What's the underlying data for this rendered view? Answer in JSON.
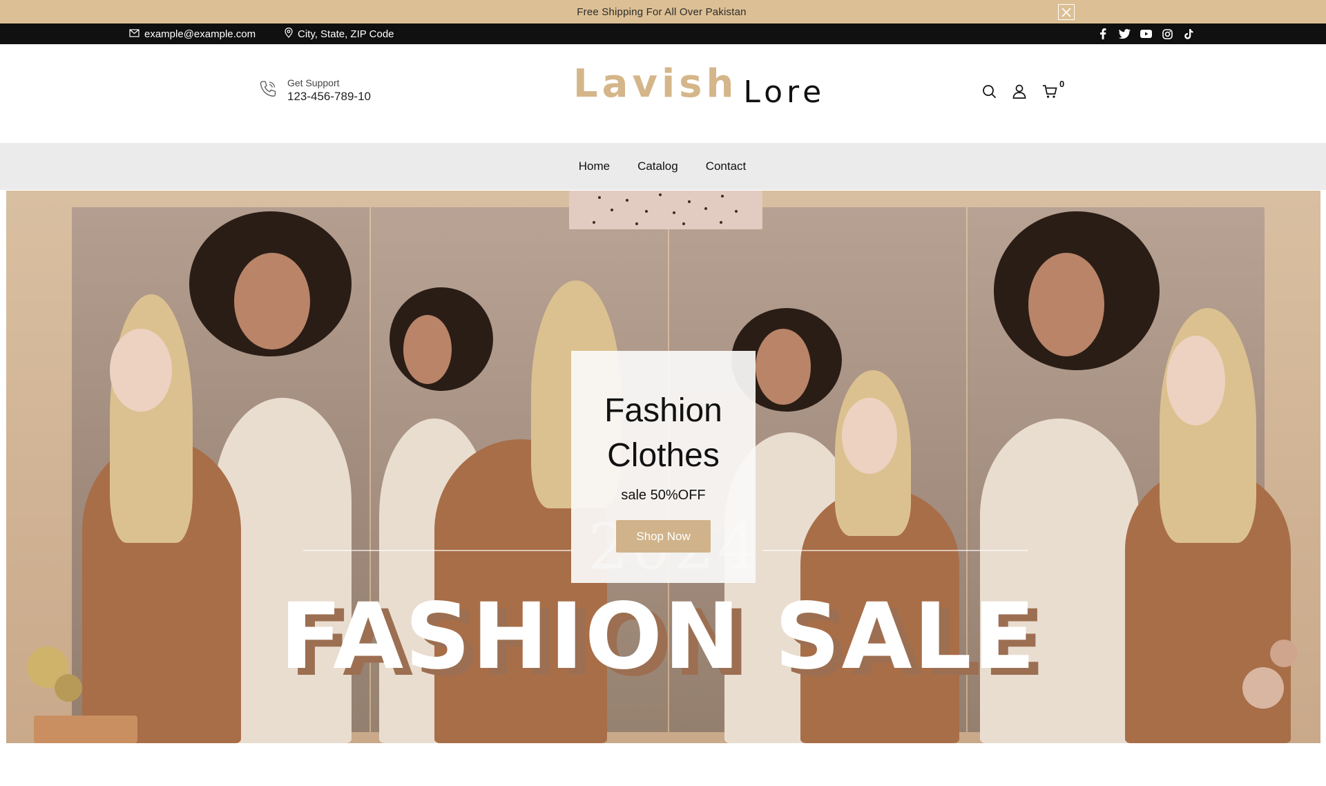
{
  "announcement": {
    "text": "Free Shipping For All Over Pakistan",
    "close_icon": "close-icon"
  },
  "topbar": {
    "email": "example@example.com",
    "address": "City, State, ZIP Code",
    "socials": [
      "facebook-icon",
      "twitter-icon",
      "youtube-icon",
      "instagram-icon",
      "tiktok-icon"
    ]
  },
  "header": {
    "support_label": "Get Support",
    "support_phone": "123-456-789-10",
    "logo_part1": "Lavish",
    "logo_part2": "Lore",
    "cart_count": "0"
  },
  "nav": {
    "items": [
      "Home",
      "Catalog",
      "Contact"
    ]
  },
  "hero": {
    "title": "Fashion Clothes",
    "subtitle": "sale 50%OFF",
    "button": "Shop Now",
    "banner_text": "FASHION SALE",
    "banner_year": "2024"
  },
  "colors": {
    "accent": "#d0b38a",
    "announce_bg": "#dcbf94",
    "topbar_bg": "#101010",
    "nav_bg": "#ebebeb"
  }
}
